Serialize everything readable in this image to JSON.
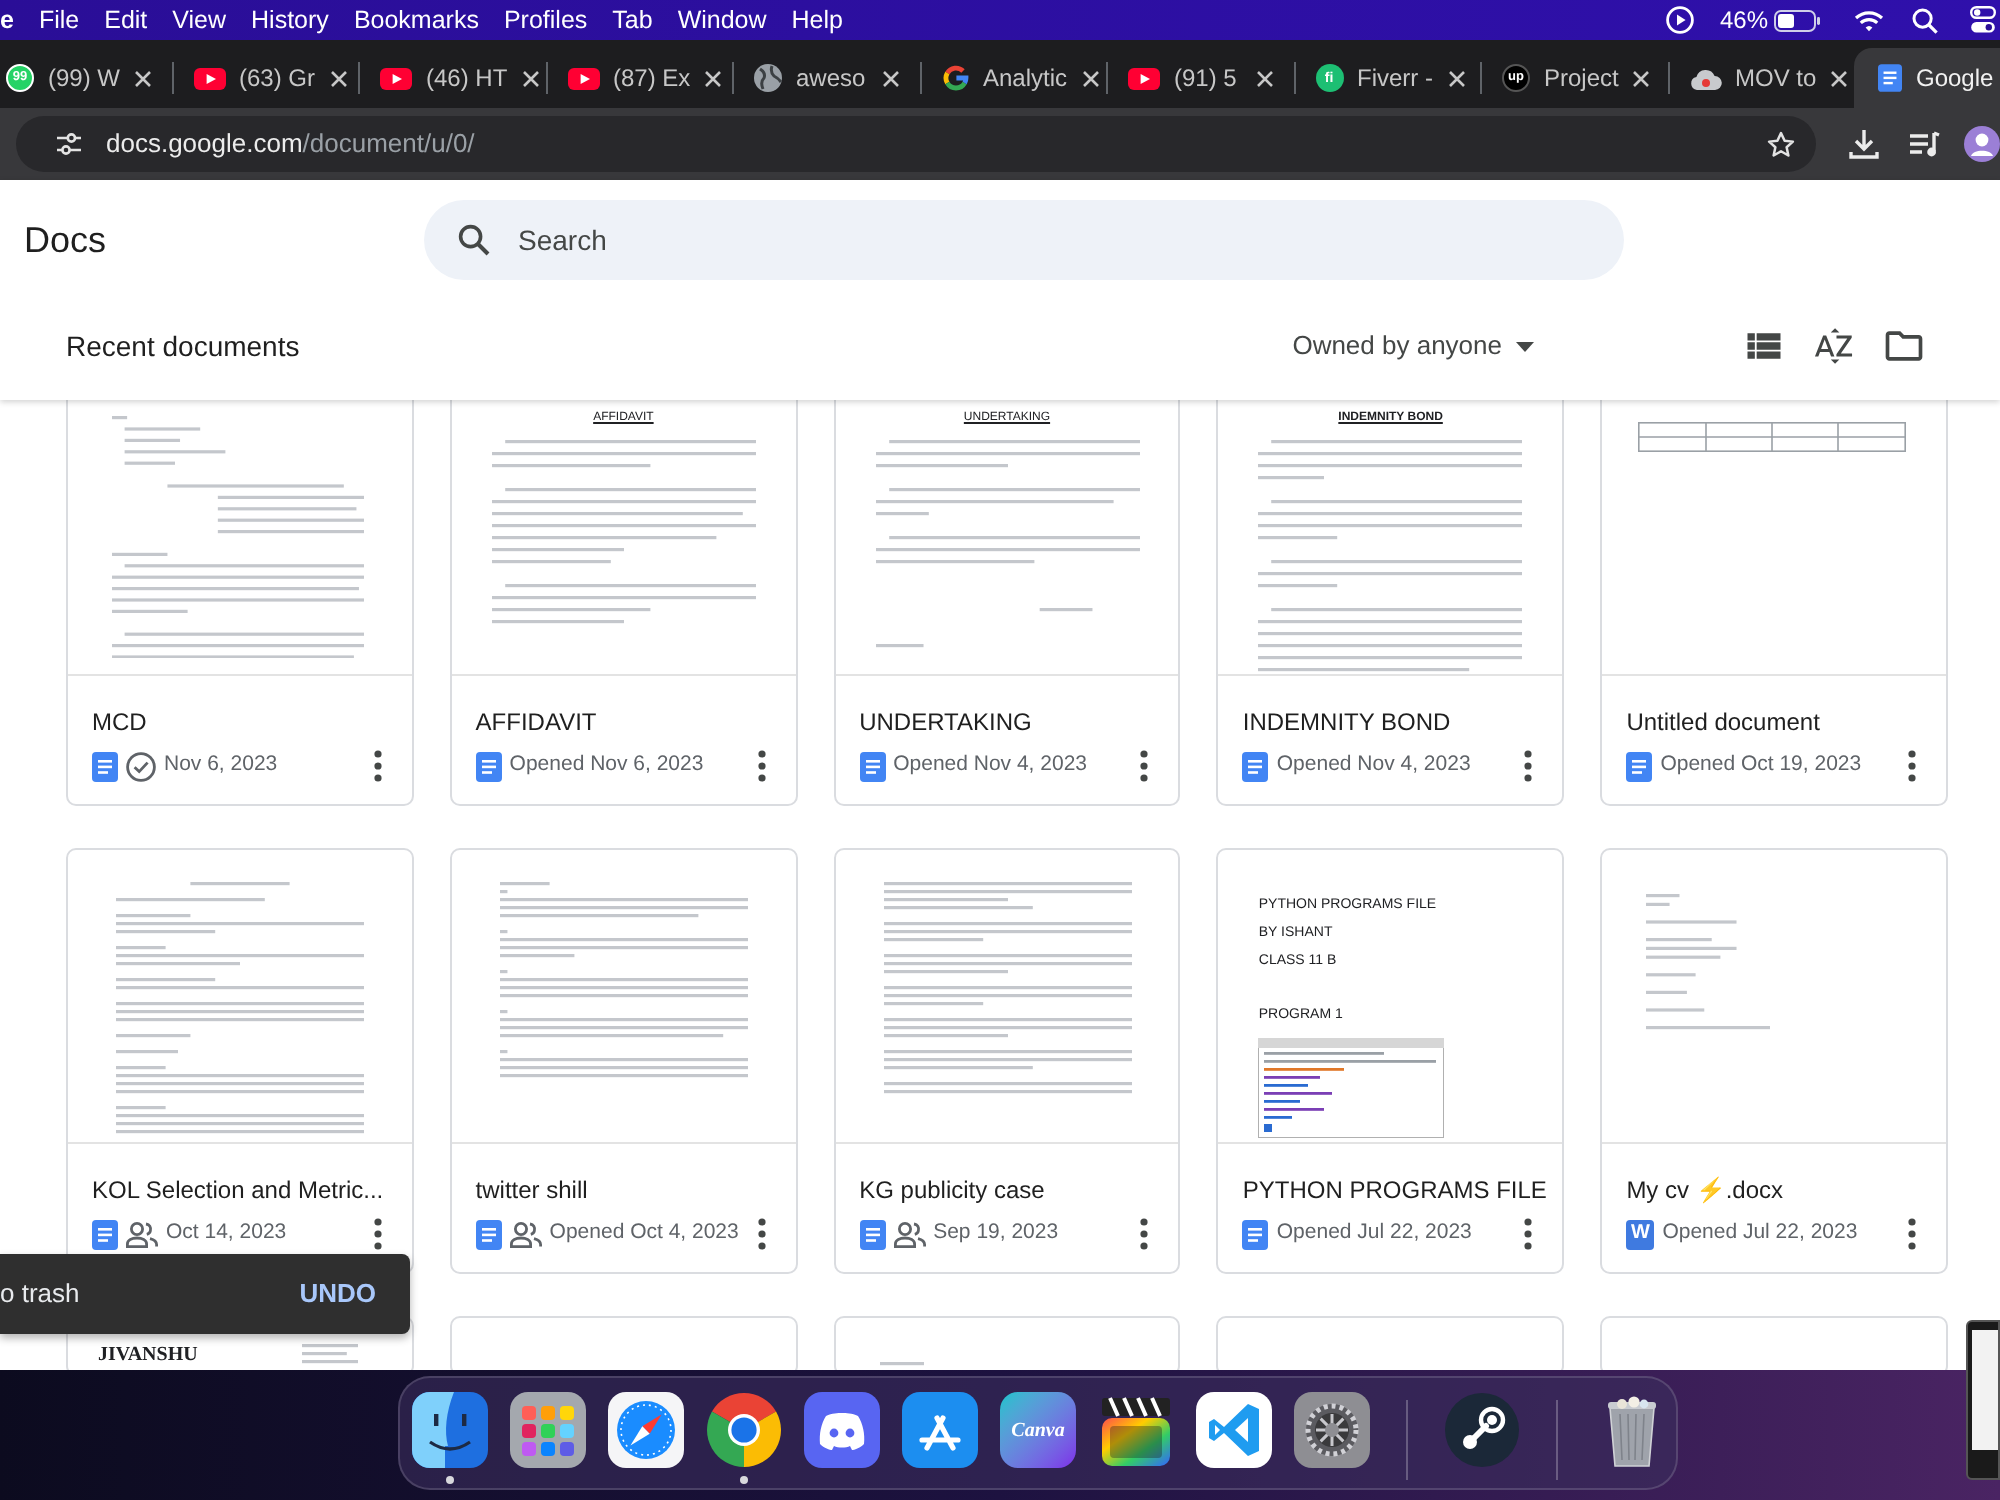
{
  "menu_bar": {
    "app_name": "e",
    "items": [
      "File",
      "Edit",
      "View",
      "History",
      "Bookmarks",
      "Profiles",
      "Tab",
      "Window",
      "Help"
    ],
    "battery_percent": "46%"
  },
  "browser": {
    "tabs": [
      {
        "title": "(99) W",
        "kind": "whatsapp",
        "favicon_label": "99",
        "selected": false
      },
      {
        "title": "(63) Gr",
        "kind": "youtube",
        "selected": false
      },
      {
        "title": "(46) HT",
        "kind": "youtube",
        "selected": false
      },
      {
        "title": "(87) Ex",
        "kind": "youtube",
        "selected": false
      },
      {
        "title": "aweso",
        "kind": "globe",
        "selected": false
      },
      {
        "title": "Analytic",
        "kind": "google",
        "selected": false
      },
      {
        "title": "(91) 5",
        "kind": "youtube",
        "selected": false
      },
      {
        "title": "Fiverr -",
        "kind": "fiverr",
        "favicon_label": "fi",
        "selected": false
      },
      {
        "title": "Project",
        "kind": "upwork",
        "favicon_label": "up",
        "selected": false
      },
      {
        "title": "MOV to",
        "kind": "cloud",
        "selected": false
      },
      {
        "title": "Google",
        "kind": "docs",
        "selected": true
      }
    ],
    "url": {
      "host": "docs.google.com",
      "path": "/document/u/0/"
    }
  },
  "docs": {
    "app_title": "Docs",
    "search": {
      "placeholder": "Search"
    },
    "section_title": "Recent documents",
    "owner_filter": "Owned by anyone",
    "documents": [
      {
        "title": "MCD",
        "kind": "doc",
        "available_offline": true,
        "shared": false,
        "date": "Nov 6, 2023",
        "preview": {
          "kind": "letter"
        }
      },
      {
        "title": "AFFIDAVIT",
        "kind": "doc",
        "available_offline": false,
        "shared": false,
        "date": "Opened Nov 6, 2023",
        "preview": {
          "kind": "headed",
          "heading": "AFFIDAVIT",
          "bold": false
        }
      },
      {
        "title": "UNDERTAKING",
        "kind": "doc",
        "available_offline": false,
        "shared": false,
        "date": "Opened Nov 4, 2023",
        "preview": {
          "kind": "headed",
          "heading": "UNDERTAKING",
          "bold": false
        }
      },
      {
        "title": "INDEMNITY BOND",
        "kind": "doc",
        "available_offline": false,
        "shared": false,
        "date": "Opened Nov 4, 2023",
        "preview": {
          "kind": "headed",
          "heading": "INDEMNITY BOND",
          "bold": true
        }
      },
      {
        "title": "Untitled document",
        "kind": "doc",
        "available_offline": false,
        "shared": false,
        "date": "Opened Oct 19, 2023",
        "preview": {
          "kind": "table"
        }
      },
      {
        "title": "KOL Selection and Metric...",
        "kind": "doc",
        "available_offline": false,
        "shared": true,
        "date": "Oct 14, 2023",
        "preview": {
          "kind": "text"
        }
      },
      {
        "title": "twitter shill",
        "kind": "doc",
        "available_offline": false,
        "shared": true,
        "date": "Opened Oct 4, 2023",
        "preview": {
          "kind": "text"
        }
      },
      {
        "title": "KG publicity case",
        "kind": "doc",
        "available_offline": false,
        "shared": true,
        "date": "Sep 19, 2023",
        "preview": {
          "kind": "text"
        }
      },
      {
        "title": "PYTHON PROGRAMS FILE",
        "kind": "doc",
        "available_offline": false,
        "shared": false,
        "date": "Opened Jul 22, 2023",
        "preview": {
          "kind": "program",
          "headings": [
            "PYTHON PROGRAMS FILE",
            "BY ISHANT",
            "CLASS 11 B",
            "PROGRAM 1"
          ]
        }
      },
      {
        "title": "My cv ⚡.docx",
        "kind": "word",
        "file_letter": "W",
        "available_offline": false,
        "shared": false,
        "date": "Opened Jul 22, 2023",
        "preview": {
          "kind": "cv"
        }
      },
      {
        "preview": {
          "kind": "resume",
          "heading": "JIVANSHU"
        }
      },
      {
        "preview": {
          "kind": "blank"
        }
      },
      {
        "preview": {
          "kind": "cv"
        }
      },
      {
        "preview": {
          "kind": "blank"
        }
      },
      {
        "preview": {
          "kind": "blank"
        }
      }
    ]
  },
  "snackbar": {
    "message": "o trash",
    "action": "UNDO"
  },
  "dock": [
    {
      "kind": "finder",
      "running": true
    },
    {
      "kind": "launchpad",
      "running": false
    },
    {
      "kind": "safari",
      "running": false
    },
    {
      "kind": "chrome",
      "running": true
    },
    {
      "kind": "discord",
      "running": false
    },
    {
      "kind": "app_store",
      "running": false
    },
    {
      "kind": "canva",
      "label": "Canva",
      "running": false
    },
    {
      "kind": "final_cut",
      "running": false
    },
    {
      "kind": "vscode",
      "running": false
    },
    {
      "kind": "settings",
      "running": false
    },
    {
      "kind": "separator"
    },
    {
      "kind": "steam",
      "running": false
    },
    {
      "kind": "separator"
    },
    {
      "kind": "trash",
      "running": false
    }
  ]
}
